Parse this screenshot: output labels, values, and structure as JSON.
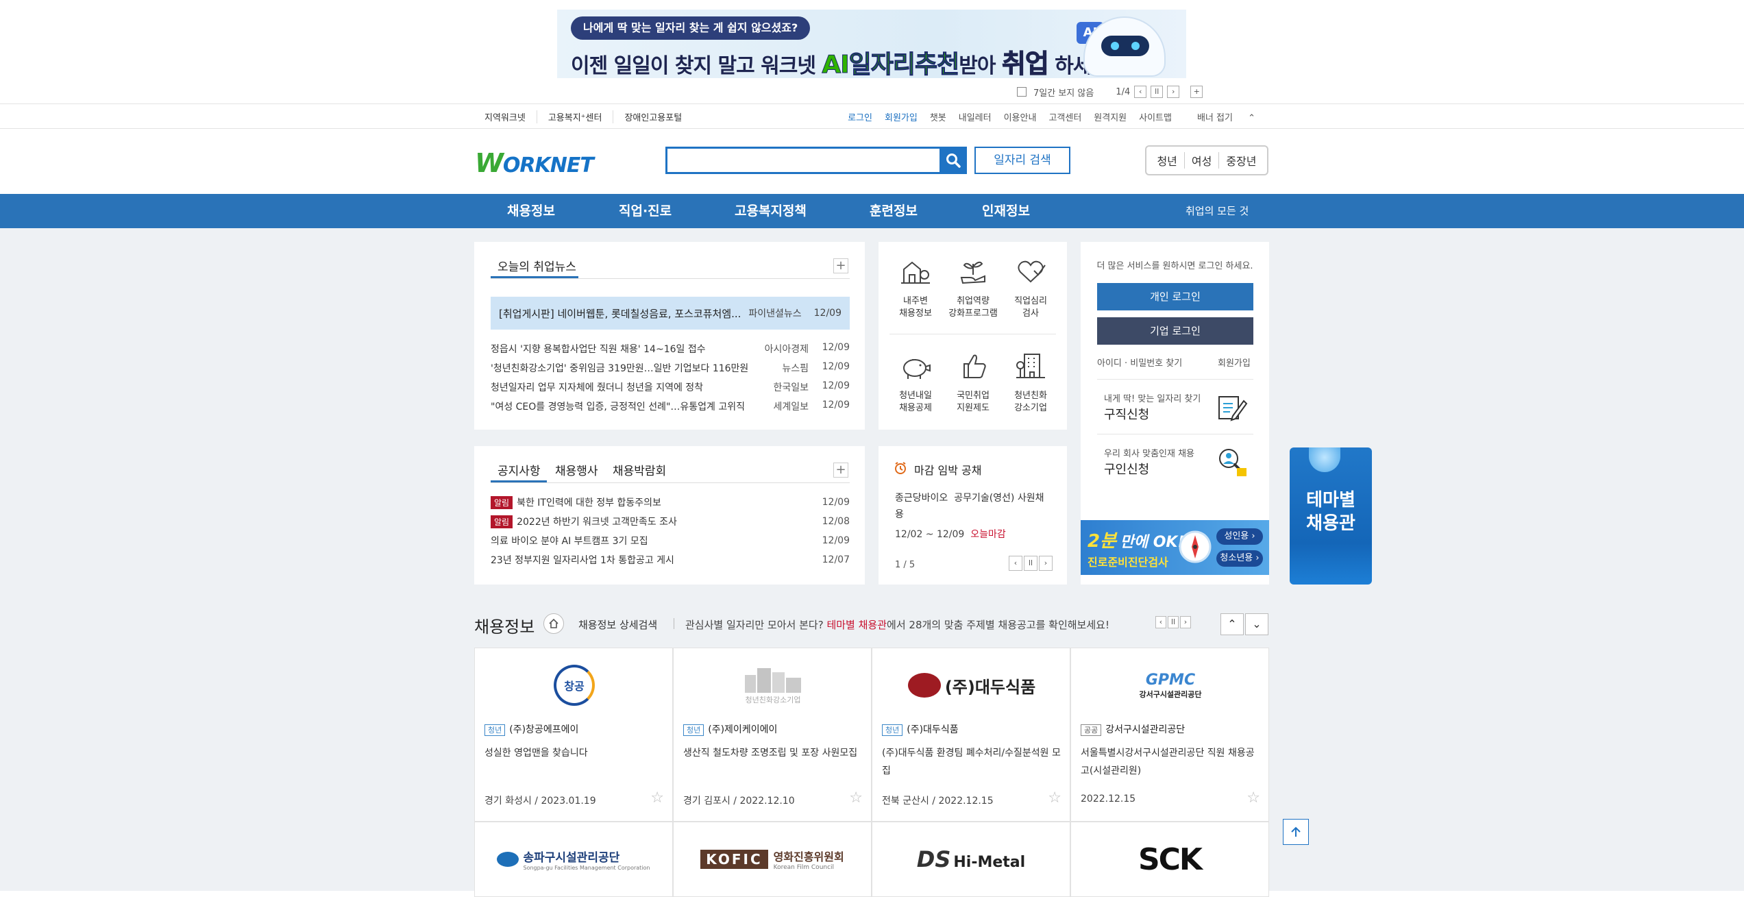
{
  "top_banner": {
    "pill": "나에게 딱 맞는 일자리 찾는 게 쉽지 않으셨죠?",
    "main_pre": "이젠 일일이 찾지 말고 워크넷 ",
    "main_highlight": "AI일자리추천",
    "main_mid": "받아 ",
    "main_highlight2": "취업",
    "main_post": " 하세요",
    "ai_chip": "AI",
    "hide_7days": "7일간 보지 않음",
    "counter": "1/4"
  },
  "util_left": [
    "지역워크넷",
    "고용복지⁺센터",
    "장애인고용포털"
  ],
  "util_right": [
    "로그인",
    "회원가입",
    "챗봇",
    "내일레터",
    "이용안내",
    "고객센터",
    "원격지원",
    "사이트맵"
  ],
  "util_fold": "배너 접기",
  "header": {
    "logo": "ORKNET",
    "logo_w": "W",
    "job_search": "일자리 검색",
    "targets": [
      "청년",
      "여성",
      "중장년"
    ]
  },
  "gnb": {
    "items": [
      "채용정보",
      "직업·진로",
      "고용복지정책",
      "훈련정보",
      "인재정보"
    ],
    "all": "취업의 모든 것"
  },
  "news": {
    "tab": "오늘의 취업뉴스",
    "featured": {
      "title": "[취업게시판] 네이버웹툰, 롯데칠성음료, 포스코퓨처엠...",
      "source": "파이낸셜뉴스",
      "date": "12/09"
    },
    "rows": [
      {
        "title": "정읍시 '지향 용복합사업단 직원 채용' 14~16일 접수",
        "source": "아시아경제",
        "date": "12/09"
      },
      {
        "title": "'청년친화강소기업' 중위임금 319만원…일반 기업보다 116만원",
        "source": "뉴스핌",
        "date": "12/09"
      },
      {
        "title": "청년일자리 업무 지자체에 줬더니 청년을 지역에 정착",
        "source": "한국일보",
        "date": "12/09"
      },
      {
        "title": "\"여성 CEO를 경영능력 입증, 긍정적인 선례\"…유통업계 고위직",
        "source": "세계일보",
        "date": "12/09"
      }
    ]
  },
  "services": [
    {
      "l1": "내주변",
      "l2": "채용정보"
    },
    {
      "l1": "취업역량",
      "l2": "강화프로그램"
    },
    {
      "l1": "직업심리",
      "l2": "검사"
    },
    {
      "l1": "청년내일",
      "l2": "채용공제"
    },
    {
      "l1": "국민취업",
      "l2": "지원제도"
    },
    {
      "l1": "청년친화",
      "l2": "강소기업"
    }
  ],
  "login": {
    "msg": "더 많은 서비스를 원하시면 로그인 하세요.",
    "personal": "개인 로그인",
    "corporate": "기업 로그인",
    "find": "아이디 · 비밀번호 찾기",
    "join": "회원가입",
    "job_sub": "내게 딱! 맞는 일자리 찾기",
    "job_title": "구직신청",
    "recruit_sub": "우리 회사 맞춤인재 채용",
    "recruit_title": "구인신청"
  },
  "notices": {
    "tabs": [
      "공지사항",
      "채용행사",
      "채용박람회"
    ],
    "tag": "알림",
    "rows": [
      {
        "tag": true,
        "title": "북한 IT인력에 대한 정부 합동주의보",
        "date": "12/09"
      },
      {
        "tag": true,
        "title": "2022년 하반기 워크넷 고객만족도 조사",
        "date": "12/08"
      },
      {
        "tag": false,
        "title": "의료 바이오 분야 AI 부트캠프 3기 모집",
        "date": "12/09"
      },
      {
        "tag": false,
        "title": "23년 정부지원 일자리사업 1차 통합공고 게시",
        "date": "12/07"
      }
    ]
  },
  "deadline": {
    "title": "마감 임박 공채",
    "company": "종근당바이오",
    "job": "공무기술(영선) 사원채용",
    "period": "12/02 ~ 12/09",
    "status": "오늘마감",
    "pager": "1 / 5"
  },
  "promo": {
    "big": "2분",
    "mid": "만에 OK!",
    "sub": "진로준비진단검사",
    "adult": "성인용 ›",
    "youth": "청소년용 ›"
  },
  "theme": {
    "l1": "테마별",
    "l2": "채용관"
  },
  "jobs": {
    "title": "채용정보",
    "detail": "채용정보 상세검색",
    "promo_pre": "관심사별 일자리만 모아서 본다?",
    "promo_link": "테마별 채용관",
    "promo_post": "에서 28개의 맞춤 주제별 채용공고를 확인해보세요!",
    "cards": [
      {
        "badge": "청년",
        "company": "(주)창공에프에이",
        "desc": "성실한 영업맨을 찾습니다",
        "loc": "경기 화성시 / 2023.01.19",
        "logo": "창공"
      },
      {
        "badge": "청년",
        "company": "(주)제이케이에이",
        "desc": "생산직 철도차량 조명조립 및 포장 사원모집",
        "loc": "경기 김포시 / 2022.12.10",
        "logo": "청년친화강소기업"
      },
      {
        "badge": "청년",
        "company": "(주)대두식품",
        "desc": "(주)대두식품 환경팀 폐수처리/수질분석원 모집",
        "loc": "전북 군산시 / 2022.12.15",
        "logo": "(주)대두식품"
      },
      {
        "badge": "공공",
        "company": "강서구시설관리공단",
        "desc": "서울특별시강서구시설관리공단 직원 채용공고(시설관리원)",
        "loc": "2022.12.15",
        "logo": "GPMC",
        "logo_sub": "강서구시설관리공단"
      }
    ],
    "logos_row2": [
      {
        "main": "송파구시설관리공단",
        "sub": "Songpa-gu Facilities Management Corporation"
      },
      {
        "main": "KOFIC",
        "sub": "영화진흥위원회",
        "sub2": "Korean Film Council"
      },
      {
        "main": "DS",
        "sub": "Hi-Metal"
      },
      {
        "main": "SCK"
      }
    ]
  },
  "colors": {
    "primary": "#2a73b8",
    "accent_red": "#b3162b",
    "bg": "#eef1f4",
    "dark_login": "#3d4a66"
  }
}
